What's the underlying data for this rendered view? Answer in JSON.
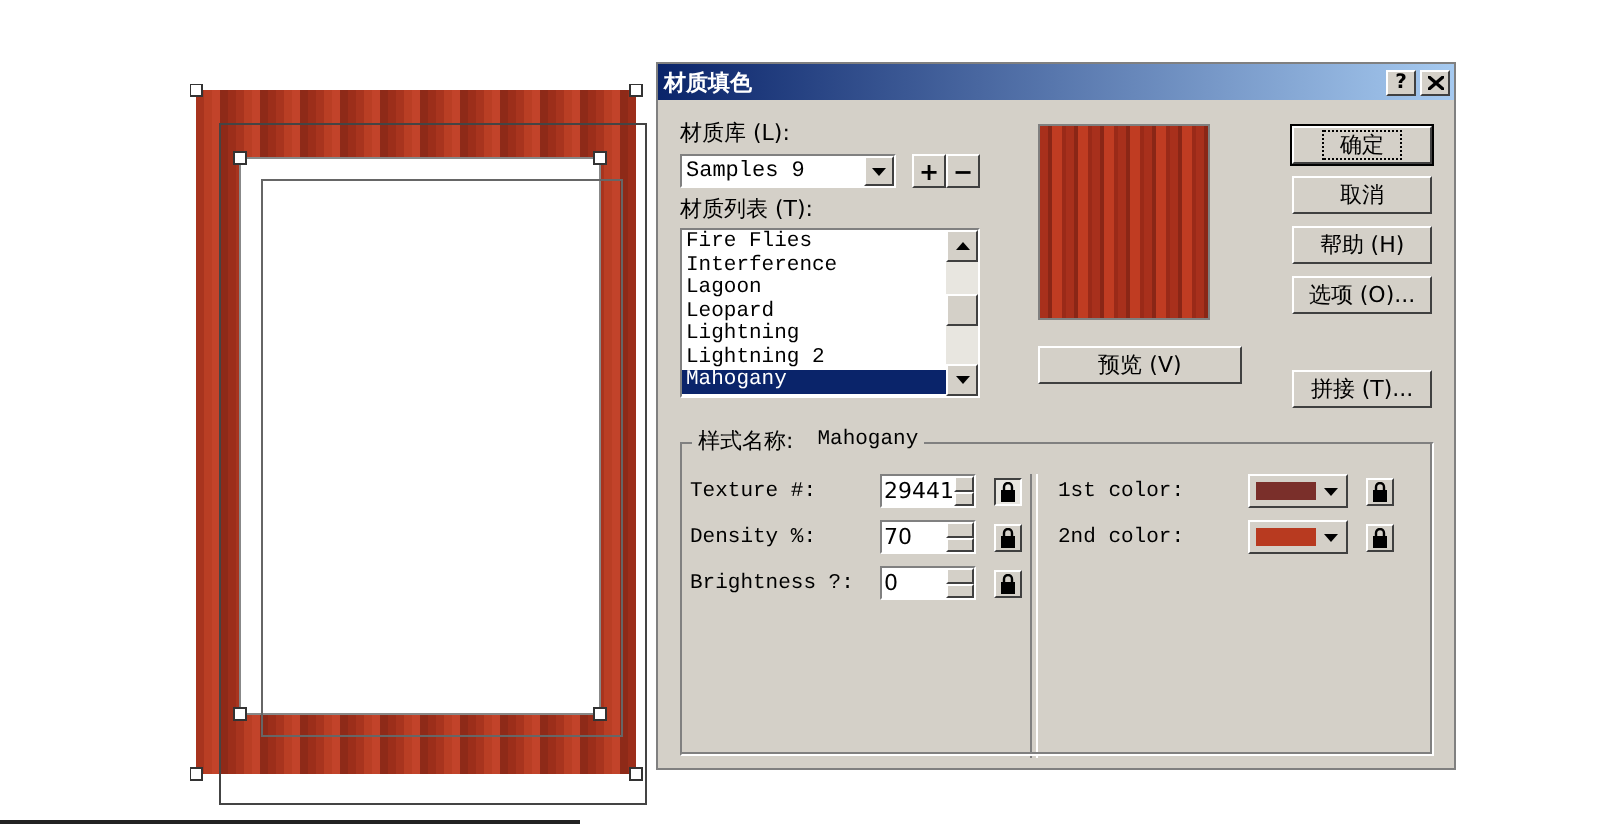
{
  "dialog": {
    "title": "材质填色",
    "help_button": "?",
    "library": {
      "label": "材质库 (L):",
      "value": "Samples 9",
      "add": "+",
      "remove": "−"
    },
    "texture_list": {
      "label": "材质列表 (T):",
      "items": [
        {
          "label": "Fire Flies",
          "selected": false
        },
        {
          "label": "Interference",
          "selected": false
        },
        {
          "label": "Lagoon",
          "selected": false
        },
        {
          "label": "Leopard",
          "selected": false
        },
        {
          "label": "Lightning",
          "selected": false
        },
        {
          "label": "Lightning 2",
          "selected": false
        },
        {
          "label": "Mahogany",
          "selected": true
        }
      ]
    },
    "preview_button": "预览 (V)",
    "buttons": [
      {
        "label": "确定",
        "default": true
      },
      {
        "label": "取消",
        "default": false
      },
      {
        "label": "帮助 (H)",
        "default": false
      },
      {
        "label": "选项 (O)...",
        "default": false
      }
    ],
    "tile_button": "拼接 (T)...",
    "style": {
      "label": "样式名称:",
      "name": "Mahogany",
      "params": [
        {
          "label": "Texture #:",
          "value": "29441",
          "pressed": true
        },
        {
          "label": "Density %:",
          "value": "70",
          "pressed": false
        },
        {
          "label": "Brightness ?:",
          "value": "0",
          "pressed": false
        }
      ],
      "colors": [
        {
          "label": "1st color:",
          "color": "#7a2f2a"
        },
        {
          "label": "2nd color:",
          "color": "#b83a20"
        }
      ]
    }
  }
}
